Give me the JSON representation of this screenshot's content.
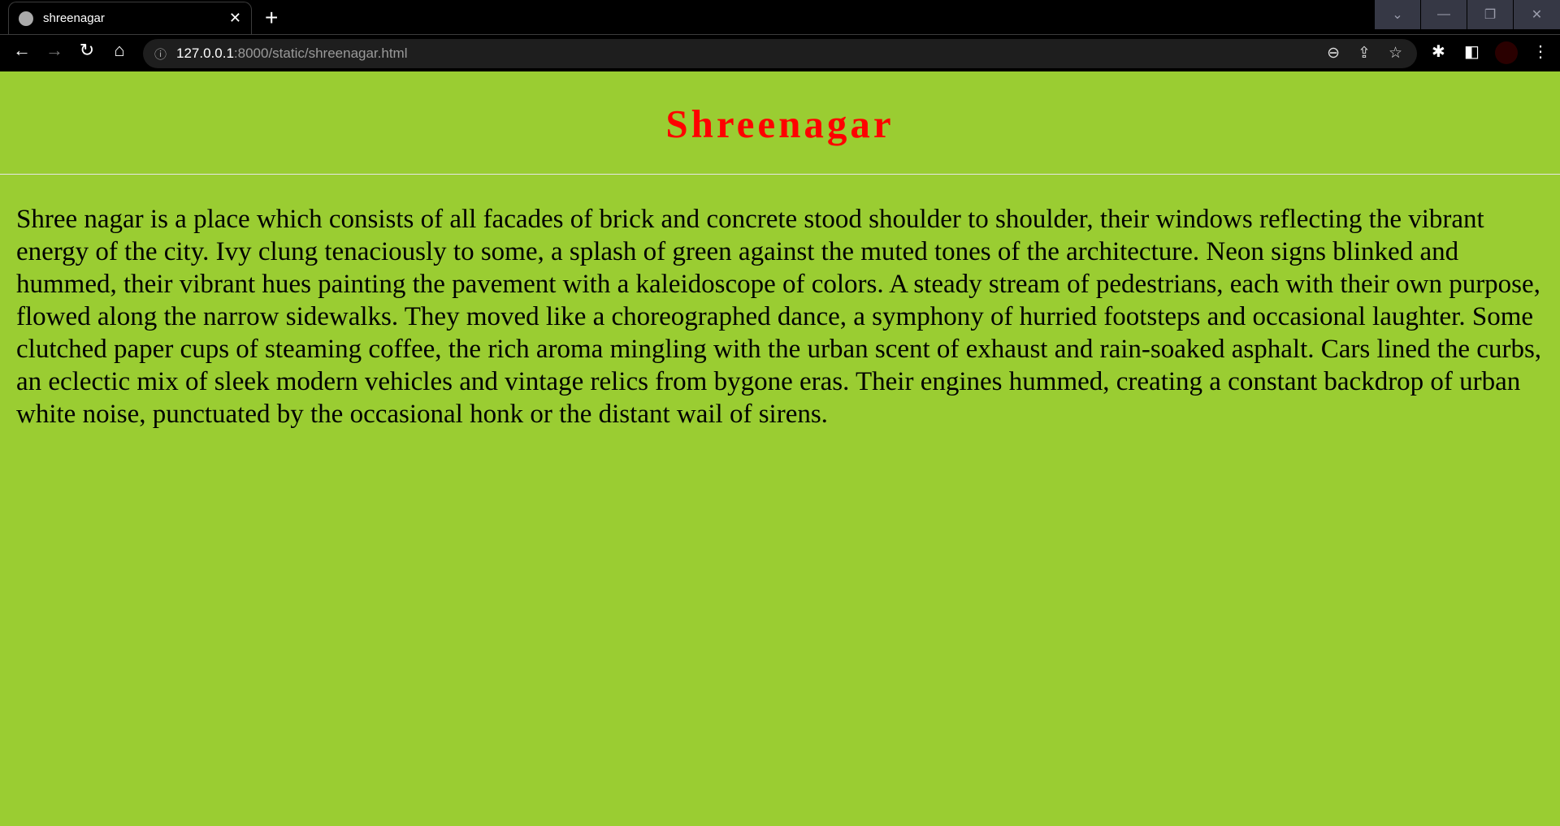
{
  "browser": {
    "tab_title": "shreenagar",
    "url_host": "127.0.0.1",
    "url_rest": ":8000/static/shreenagar.html"
  },
  "page": {
    "title": "Shreenagar",
    "paragraph": "Shree nagar is a place which consists of all facades of brick and concrete stood shoulder to shoulder, their windows reflecting the vibrant energy of the city. Ivy clung tenaciously to some, a splash of green against the muted tones of the architecture. Neon signs blinked and hummed, their vibrant hues painting the pavement with a kaleidoscope of colors. A steady stream of pedestrians, each with their own purpose, flowed along the narrow sidewalks. They moved like a choreographed dance, a symphony of hurried footsteps and occasional laughter. Some clutched paper cups of steaming coffee, the rich aroma mingling with the urban scent of exhaust and rain-soaked asphalt. Cars lined the curbs, an eclectic mix of sleek modern vehicles and vintage relics from bygone eras. Their engines hummed, creating a constant backdrop of urban white noise, punctuated by the occasional honk or the distant wail of sirens."
  },
  "colors": {
    "background": "#9acd32",
    "title": "#ff0000"
  }
}
